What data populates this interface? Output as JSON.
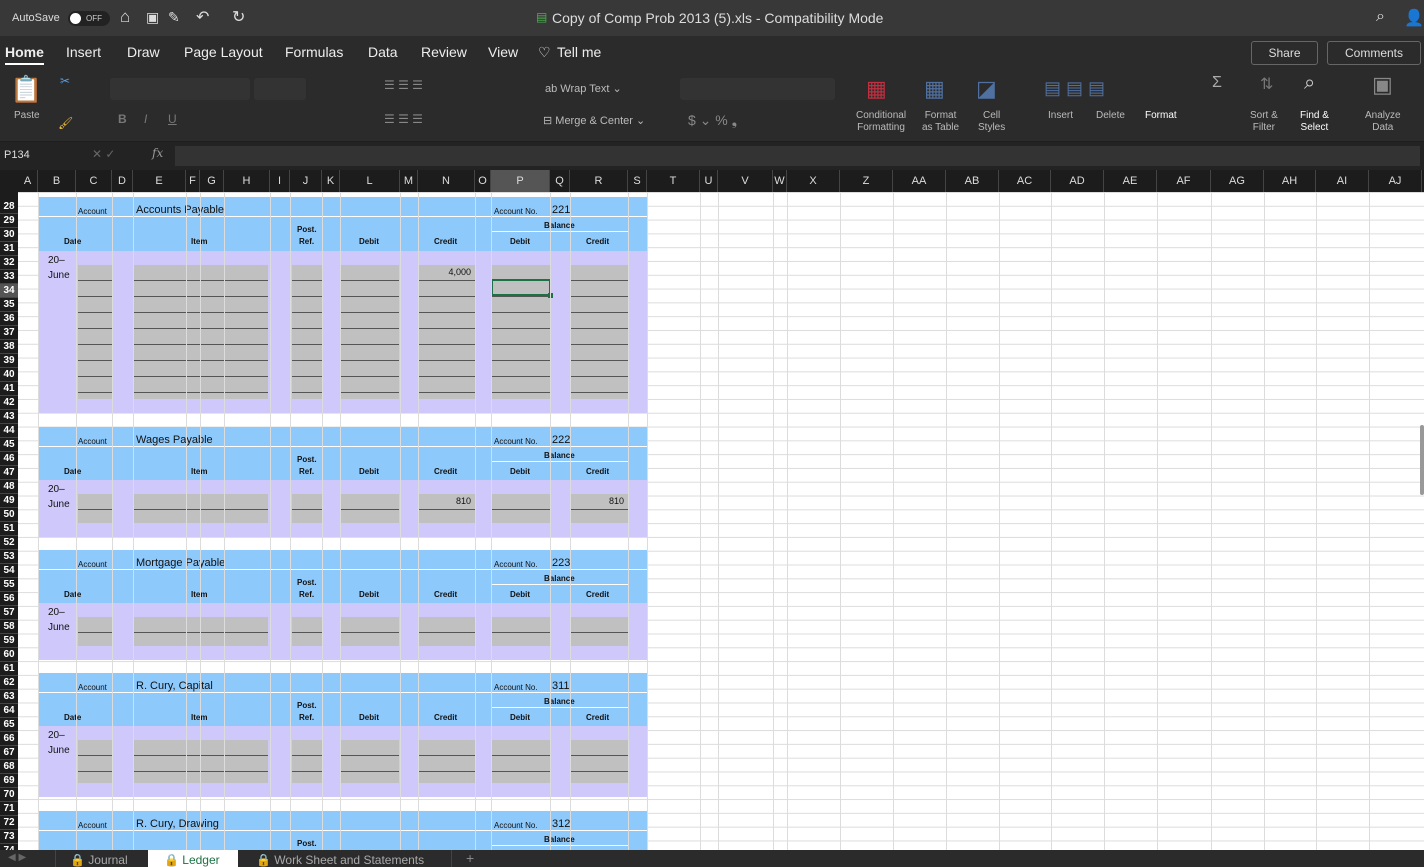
{
  "titlebar": {
    "autosave": "AutoSave",
    "toggle": "OFF",
    "title": "Copy of Comp Prob 2013 (5).xls  -  Compatibility Mode"
  },
  "menu": [
    "Home",
    "Insert",
    "Draw",
    "Page Layout",
    "Formulas",
    "Data",
    "Review",
    "View",
    "Tell me"
  ],
  "share": "Share",
  "comments": "Comments",
  "ribbon": {
    "paste": "Paste",
    "wrap": "Wrap Text",
    "merge": "Merge & Center",
    "cond": [
      "Conditional",
      "Formatting"
    ],
    "fmt_table": [
      "Format",
      "as Table"
    ],
    "cell_styles": [
      "Cell",
      "Styles"
    ],
    "insert": "Insert",
    "delete": "Delete",
    "format": "Format",
    "sort": [
      "Sort &",
      "Filter"
    ],
    "find": [
      "Find &",
      "Select"
    ],
    "analyze": [
      "Analyze",
      "Data"
    ]
  },
  "namebox": "P134",
  "fx": "fx",
  "columns": [
    "A",
    "B",
    "C",
    "D",
    "E",
    "F",
    "G",
    "H",
    "I",
    "J",
    "K",
    "L",
    "M",
    "N",
    "O",
    "P",
    "Q",
    "R",
    "S",
    "T",
    "U",
    "V",
    "W",
    "X",
    "Z",
    "AA",
    "AB",
    "AC",
    "AD",
    "AE",
    "AF",
    "AG",
    "AH",
    "AI",
    "AJ"
  ],
  "rows": [
    "28",
    "29",
    "30",
    "31",
    "32",
    "33",
    "34",
    "35",
    "36",
    "37",
    "38",
    "39",
    "40",
    "41",
    "42",
    "43",
    "44",
    "45",
    "46",
    "47",
    "48",
    "49",
    "50",
    "51",
    "52",
    "53",
    "54",
    "55",
    "56",
    "57",
    "58",
    "59",
    "60",
    "61",
    "62",
    "63",
    "64",
    "65",
    "66",
    "67",
    "68",
    "69",
    "70",
    "71",
    "72",
    "73",
    "74"
  ],
  "labels": {
    "account": "Account",
    "account_no": "Account No.",
    "balance": "Balance",
    "date": "Date",
    "item": "Item",
    "post": "Post.",
    "ref": "Ref.",
    "debit": "Debit",
    "credit": "Credit",
    "year": "20–",
    "month": "June"
  },
  "accounts": [
    {
      "name": "Accounts Payable",
      "no": "221",
      "credit": "4,000",
      "bal_credit": ""
    },
    {
      "name": "Wages Payable",
      "no": "222",
      "credit": "810",
      "bal_credit": "810"
    },
    {
      "name": "Mortgage Payable",
      "no": "223",
      "credit": "",
      "bal_credit": ""
    },
    {
      "name": "R. Cury, Capital",
      "no": "311",
      "credit": "",
      "bal_credit": ""
    },
    {
      "name": "R. Cury, Drawing",
      "no": "312",
      "credit": "",
      "bal_credit": ""
    }
  ],
  "sheets": [
    "Journal",
    "Ledger",
    "Work Sheet and Statements"
  ],
  "add_sheet": "+"
}
